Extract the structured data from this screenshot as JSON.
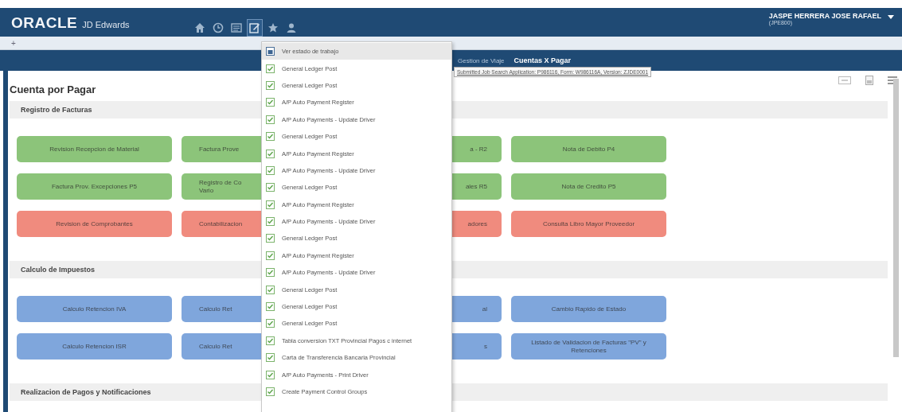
{
  "header": {
    "logo": "ORACLE",
    "product": "JD Edwards",
    "user": "JASPE HERRERA JOSE RAFAEL",
    "user_env": "(JPE800)",
    "nav_icons": [
      {
        "kind": "home",
        "selected": false
      },
      {
        "kind": "clock",
        "selected": false
      },
      {
        "kind": "list",
        "selected": false
      },
      {
        "kind": "edit",
        "selected": true
      },
      {
        "kind": "star",
        "selected": false
      },
      {
        "kind": "person",
        "selected": false
      }
    ]
  },
  "add_tab": "+",
  "breadcrumb": [
    {
      "label": "Gestion de Viaje",
      "selected": false
    },
    {
      "label": "Cuentas X Pagar",
      "selected": true
    }
  ],
  "tooltip": "Submitted Job Search Application: P986116, Form: W986116A, Version: ZJDE0001",
  "page_title": "Cuenta por Pagar",
  "sections": [
    {
      "title": "Registro de Facturas",
      "rows": [
        [
          {
            "label": "Revision Recepcion de Material",
            "color": "#8cc47a"
          },
          {
            "label": "Factura Prove",
            "color": "#8cc47a"
          },
          {
            "label": "a - R2",
            "color": "#8cc47a"
          },
          {
            "label": "Nota de Debito P4",
            "color": "#8cc47a"
          }
        ],
        [
          {
            "label": "Factura Prov. Excepciones P5",
            "color": "#8cc47a"
          },
          {
            "label": "Registro de Co\nVario",
            "color": "#8cc47a"
          },
          {
            "label": "ales R5",
            "color": "#8cc47a"
          },
          {
            "label": "Nota de Credito P5",
            "color": "#8cc47a"
          }
        ],
        [
          {
            "label": "Revision de Comprobantes",
            "color": "#f08b7e"
          },
          {
            "label": "Contabilizacion",
            "color": "#f08b7e"
          },
          {
            "label": "adores",
            "color": "#f08b7e"
          },
          {
            "label": "Consulta Libro Mayor Proveedor",
            "color": "#f08b7e"
          }
        ]
      ]
    },
    {
      "title": "Calculo de Impuestos",
      "rows": [
        [
          {
            "label": "Calculo Retencion IVA",
            "color": "#7fa6dc"
          },
          {
            "label": "Calculo Ret",
            "color": "#7fa6dc"
          },
          {
            "label": "al",
            "color": "#7fa6dc"
          },
          {
            "label": "Cambio Rapido de Estado",
            "color": "#7fa6dc"
          }
        ],
        [
          {
            "label": "Calculo Retencion ISR",
            "color": "#7fa6dc"
          },
          {
            "label": "Calculo Ret",
            "color": "#7fa6dc"
          },
          {
            "label": "s",
            "color": "#7fa6dc"
          },
          {
            "label": "Listado de Validacion de Facturas \"PV\" y Retenciones",
            "color": "#7fa6dc"
          }
        ]
      ]
    },
    {
      "title": "Realizacion de Pagos y Notificaciones"
    }
  ],
  "menu": [
    {
      "label": "Ver estado de trabajo",
      "kind": "status",
      "selected": true
    },
    {
      "label": "General Ledger Post",
      "kind": "report",
      "selected": false
    },
    {
      "label": "General Ledger Post",
      "kind": "report",
      "selected": false
    },
    {
      "label": "A/P Auto Payment Register",
      "kind": "report",
      "selected": false
    },
    {
      "label": "A/P Auto Payments - Update Driver",
      "kind": "report",
      "selected": false
    },
    {
      "label": "General Ledger Post",
      "kind": "report",
      "selected": false
    },
    {
      "label": "A/P Auto Payment Register",
      "kind": "report",
      "selected": false
    },
    {
      "label": "A/P Auto Payments - Update Driver",
      "kind": "report",
      "selected": false
    },
    {
      "label": "General Ledger Post",
      "kind": "report",
      "selected": false
    },
    {
      "label": "A/P Auto Payment Register",
      "kind": "report",
      "selected": false
    },
    {
      "label": "A/P Auto Payments - Update Driver",
      "kind": "report",
      "selected": false
    },
    {
      "label": "General Ledger Post",
      "kind": "report",
      "selected": false
    },
    {
      "label": "A/P Auto Payment Register",
      "kind": "report",
      "selected": false
    },
    {
      "label": "A/P Auto Payments - Update Driver",
      "kind": "report",
      "selected": false
    },
    {
      "label": "General Ledger Post",
      "kind": "report",
      "selected": false
    },
    {
      "label": "General Ledger Post",
      "kind": "report",
      "selected": false
    },
    {
      "label": "General Ledger Post",
      "kind": "report",
      "selected": false
    },
    {
      "label": "Tabla conversion TXT Provincial Pagos c internet",
      "kind": "report",
      "selected": false
    },
    {
      "label": "Carta de Transferencia Bancaria Provincial",
      "kind": "report",
      "selected": false
    },
    {
      "label": "A/P Auto Payments - Print Driver",
      "kind": "report",
      "selected": false
    },
    {
      "label": "Create Payment Control Groups",
      "kind": "report",
      "selected": false
    }
  ]
}
